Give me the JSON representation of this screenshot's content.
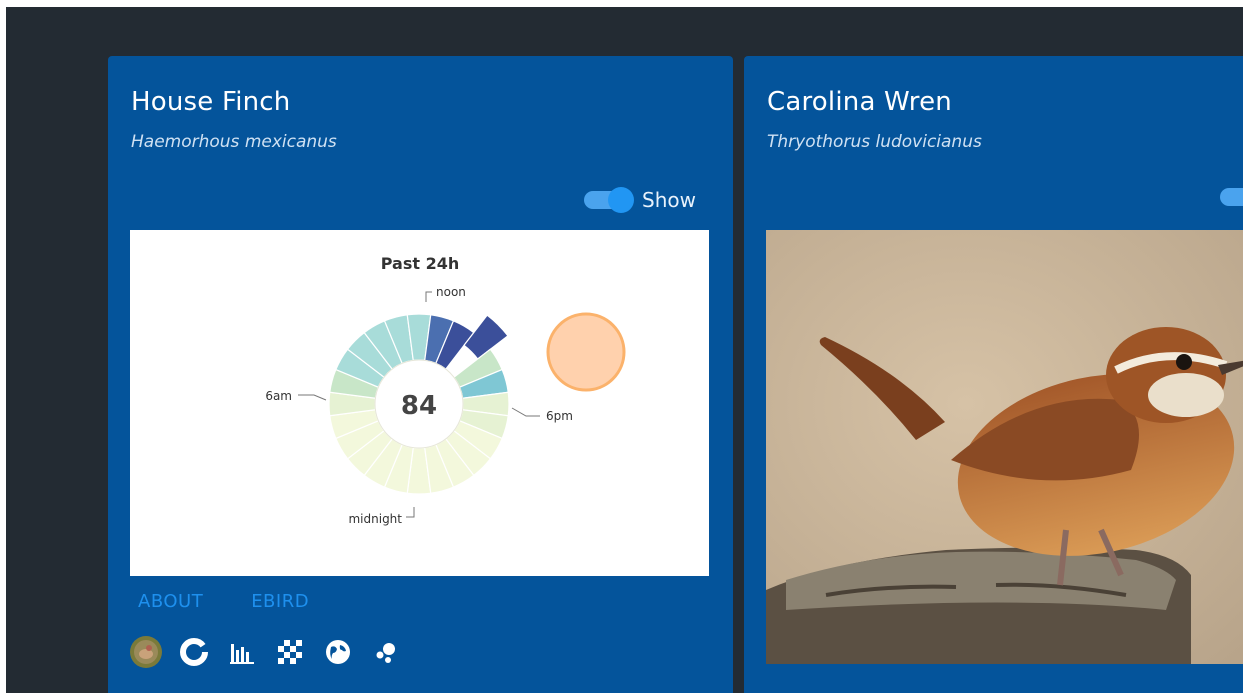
{
  "cards": [
    {
      "title": "House Finch",
      "scientific_name": "Haemorhous mexicanus",
      "toggle_label": "Show",
      "toggle_on": true,
      "links": [
        "ABOUT",
        "EBIRD"
      ],
      "icons": [
        "bird-avatar-icon",
        "donut-chart-icon",
        "bar-chart-icon",
        "heatmap-icon",
        "globe-icon",
        "bubble-chart-icon"
      ]
    },
    {
      "title": "Carolina Wren",
      "scientific_name": "Thryothorus ludovicianus",
      "toggle_on": true,
      "links": [
        "ABOUT",
        "EBIRD"
      ]
    }
  ],
  "chart_data": {
    "type": "radial-bar",
    "title": "Past 24h",
    "center_value": "84",
    "hour_labels": {
      "noon": "noon",
      "6am": "6am",
      "6pm": "6pm",
      "midnight": "midnight"
    },
    "hours": [
      0,
      1,
      2,
      3,
      4,
      5,
      6,
      7,
      8,
      9,
      10,
      11,
      12,
      13,
      14,
      15,
      16,
      17,
      18,
      19,
      20,
      21,
      22,
      23
    ],
    "values": [
      1,
      1,
      1,
      1,
      1,
      1,
      2,
      3,
      4,
      5,
      5,
      5,
      5,
      8,
      9,
      15,
      3,
      6,
      2,
      2,
      1,
      1,
      1,
      1
    ],
    "current_hour": 15
  },
  "colors": {
    "card_bg": "#04549b",
    "app_bg": "#232b33",
    "link": "#1e90ee",
    "toggle": "#2196f3"
  }
}
